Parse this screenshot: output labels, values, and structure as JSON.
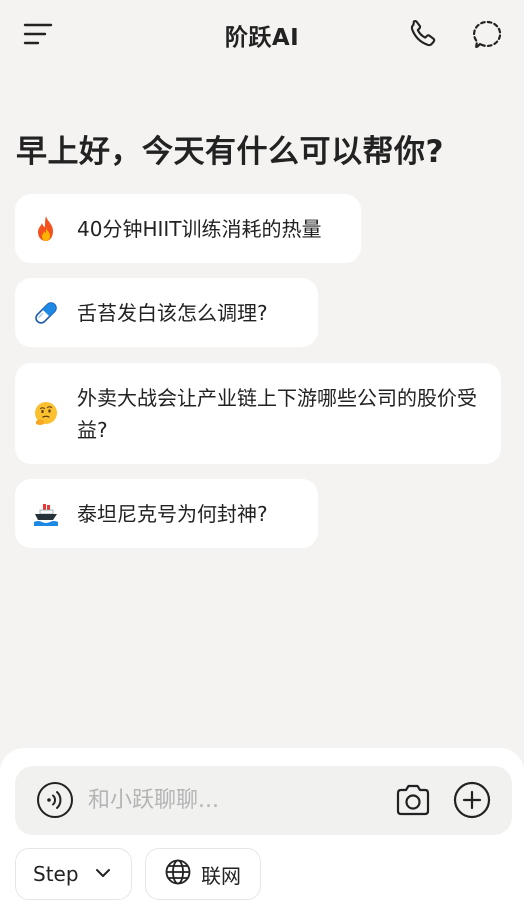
{
  "header": {
    "title": "阶跃AI",
    "icons": {
      "menu": "menu-icon",
      "phone": "phone-icon",
      "new_chat": "new-chat-icon"
    }
  },
  "greeting": "早上好，今天有什么可以帮你?",
  "suggestions": [
    {
      "emoji": "fire",
      "text": "40分钟HIIT训练消耗的热量"
    },
    {
      "emoji": "pill",
      "text": "舌苔发白该怎么调理?"
    },
    {
      "emoji": "thinking-face",
      "text": "外卖大战会让产业链上下游哪些公司的股价受益?"
    },
    {
      "emoji": "ship",
      "text": "泰坦尼克号为何封神?"
    }
  ],
  "composer": {
    "placeholder": "和小跃聊聊...",
    "value": "",
    "model_label": "Step",
    "web_label": "联网",
    "icons": {
      "voice": "voice-icon",
      "camera": "camera-icon",
      "add": "add-icon",
      "web": "globe-icon",
      "dropdown": "chevron-down-icon"
    }
  },
  "colors": {
    "background": "#f4f3f1",
    "card": "#ffffff",
    "text": "#222222",
    "placeholder": "#b4b4b4"
  }
}
